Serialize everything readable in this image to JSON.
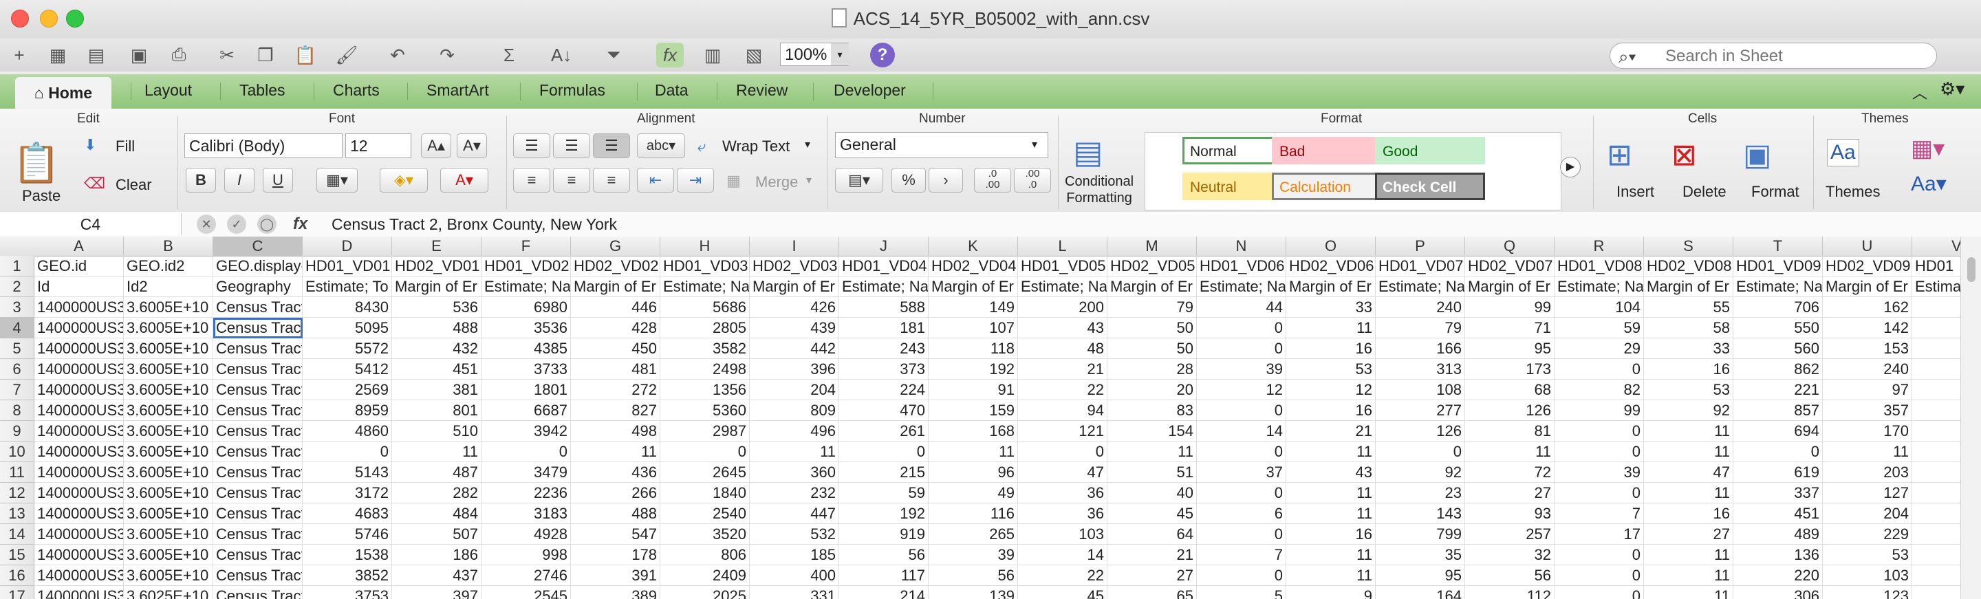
{
  "window": {
    "title": "ACS_14_5YR_B05002_with_ann.csv"
  },
  "toolbar": {
    "zoom": "100%",
    "search_placeholder": "Search in Sheet"
  },
  "ribbon_tabs": [
    "Home",
    "Layout",
    "Tables",
    "Charts",
    "SmartArt",
    "Formulas",
    "Data",
    "Review",
    "Developer"
  ],
  "ribbon": {
    "groups": {
      "edit": "Edit",
      "font": "Font",
      "alignment": "Alignment",
      "number": "Number",
      "format": "Format",
      "cells": "Cells",
      "themes": "Themes"
    },
    "paste": "Paste",
    "fill": "Fill",
    "clear": "Clear",
    "font_name": "Calibri (Body)",
    "font_size": "12",
    "bold": "B",
    "italic": "I",
    "underline": "U",
    "wrap_text": "Wrap Text",
    "merge": "Merge",
    "abc": "abc",
    "number_format": "General",
    "percent": "%",
    "comma": "›",
    "dec_inc": ".0\n.00",
    "dec_dec": ".00\n.0",
    "conditional_formatting": "Conditional\nFormatting",
    "styles": [
      {
        "name": "Normal",
        "bg": "#ffffff",
        "color": "#222222",
        "border": "#5aa65a"
      },
      {
        "name": "Bad",
        "bg": "#ffc7ce",
        "color": "#9c0006",
        "border": "#ffc7ce"
      },
      {
        "name": "Good",
        "bg": "#c6efce",
        "color": "#006100",
        "border": "#c6efce"
      },
      {
        "name": "Neutral",
        "bg": "#ffeb9c",
        "color": "#9c6500",
        "border": "#ffeb9c"
      },
      {
        "name": "Calculation",
        "bg": "#f2f2f2",
        "color": "#fa7d00",
        "border": "#7f7f7f"
      },
      {
        "name": "Check Cell",
        "bg": "#a5a5a5",
        "color": "#ffffff",
        "border": "#3f3f3f"
      }
    ],
    "insert": "Insert",
    "delete": "Delete",
    "format_cells": "Format",
    "themes_btn": "Themes",
    "font_theme": "Aa"
  },
  "formula_bar": {
    "cell_ref": "C4",
    "fx": "fx",
    "content": "Census Tract 2, Bronx County, New York"
  },
  "sheet": {
    "columns": [
      "A",
      "B",
      "C",
      "D",
      "E",
      "F",
      "G",
      "H",
      "I",
      "J",
      "K",
      "L",
      "M",
      "N",
      "O",
      "P",
      "Q",
      "R",
      "S",
      "T",
      "U",
      "V"
    ],
    "row_numbers": [
      1,
      2,
      3,
      4,
      5,
      6,
      7,
      8,
      9,
      10,
      11,
      12,
      13,
      14,
      15,
      16,
      17
    ],
    "rows": [
      [
        "GEO.id",
        "GEO.id2",
        "GEO.display-",
        "HD01_VD01",
        "HD02_VD01",
        "HD01_VD02",
        "HD02_VD02",
        "HD01_VD03",
        "HD02_VD03",
        "HD01_VD04",
        "HD02_VD04",
        "HD01_VD05",
        "HD02_VD05",
        "HD01_VD06",
        "HD02_VD06",
        "HD01_VD07",
        "HD02_VD07",
        "HD01_VD08",
        "HD02_VD08",
        "HD01_VD09",
        "HD02_VD09",
        "HD01"
      ],
      [
        "Id",
        "Id2",
        "Geography",
        "Estimate; To",
        "Margin of Er",
        "Estimate; Na",
        "Margin of Er",
        "Estimate; Na",
        "Margin of Er",
        "Estimate; Na",
        "Margin of Er",
        "Estimate; Na",
        "Margin of Er",
        "Estimate; Na",
        "Margin of Er",
        "Estimate; Na",
        "Margin of Er",
        "Estimate; Na",
        "Margin of Er",
        "Estimate; Na",
        "Margin of Er",
        "Estima"
      ],
      [
        "1400000US3",
        "3.6005E+10",
        "Census Tract",
        "8430",
        "536",
        "6980",
        "446",
        "5686",
        "426",
        "588",
        "149",
        "200",
        "79",
        "44",
        "33",
        "240",
        "99",
        "104",
        "55",
        "706",
        "162",
        ""
      ],
      [
        "1400000US3",
        "3.6005E+10",
        "Census Tract",
        "5095",
        "488",
        "3536",
        "428",
        "2805",
        "439",
        "181",
        "107",
        "43",
        "50",
        "0",
        "11",
        "79",
        "71",
        "59",
        "58",
        "550",
        "142",
        ""
      ],
      [
        "1400000US3",
        "3.6005E+10",
        "Census Tract",
        "5572",
        "432",
        "4385",
        "450",
        "3582",
        "442",
        "243",
        "118",
        "48",
        "50",
        "0",
        "16",
        "166",
        "95",
        "29",
        "33",
        "560",
        "153",
        ""
      ],
      [
        "1400000US3",
        "3.6005E+10",
        "Census Tract",
        "5412",
        "451",
        "3733",
        "481",
        "2498",
        "396",
        "373",
        "192",
        "21",
        "28",
        "39",
        "53",
        "313",
        "173",
        "0",
        "16",
        "862",
        "240",
        ""
      ],
      [
        "1400000US3",
        "3.6005E+10",
        "Census Tract",
        "2569",
        "381",
        "1801",
        "272",
        "1356",
        "204",
        "224",
        "91",
        "22",
        "20",
        "12",
        "12",
        "108",
        "68",
        "82",
        "53",
        "221",
        "97",
        ""
      ],
      [
        "1400000US3",
        "3.6005E+10",
        "Census Tract",
        "8959",
        "801",
        "6687",
        "827",
        "5360",
        "809",
        "470",
        "159",
        "94",
        "83",
        "0",
        "16",
        "277",
        "126",
        "99",
        "92",
        "857",
        "357",
        ""
      ],
      [
        "1400000US3",
        "3.6005E+10",
        "Census Tract",
        "4860",
        "510",
        "3942",
        "498",
        "2987",
        "496",
        "261",
        "168",
        "121",
        "154",
        "14",
        "21",
        "126",
        "81",
        "0",
        "11",
        "694",
        "170",
        ""
      ],
      [
        "1400000US3",
        "3.6005E+10",
        "Census Tract",
        "0",
        "11",
        "0",
        "11",
        "0",
        "11",
        "0",
        "11",
        "0",
        "11",
        "0",
        "11",
        "0",
        "11",
        "0",
        "11",
        "0",
        "11",
        ""
      ],
      [
        "1400000US3",
        "3.6005E+10",
        "Census Tract",
        "5143",
        "487",
        "3479",
        "436",
        "2645",
        "360",
        "215",
        "96",
        "47",
        "51",
        "37",
        "43",
        "92",
        "72",
        "39",
        "47",
        "619",
        "203",
        ""
      ],
      [
        "1400000US3",
        "3.6005E+10",
        "Census Tract",
        "3172",
        "282",
        "2236",
        "266",
        "1840",
        "232",
        "59",
        "49",
        "36",
        "40",
        "0",
        "11",
        "23",
        "27",
        "0",
        "11",
        "337",
        "127",
        ""
      ],
      [
        "1400000US3",
        "3.6005E+10",
        "Census Tract",
        "4683",
        "484",
        "3183",
        "488",
        "2540",
        "447",
        "192",
        "116",
        "36",
        "45",
        "6",
        "11",
        "143",
        "93",
        "7",
        "16",
        "451",
        "204",
        ""
      ],
      [
        "1400000US3",
        "3.6005E+10",
        "Census Tract",
        "5746",
        "507",
        "4928",
        "547",
        "3520",
        "532",
        "919",
        "265",
        "103",
        "64",
        "0",
        "16",
        "799",
        "257",
        "17",
        "27",
        "489",
        "229",
        ""
      ],
      [
        "1400000US3",
        "3.6005E+10",
        "Census Tract",
        "1538",
        "186",
        "998",
        "178",
        "806",
        "185",
        "56",
        "39",
        "14",
        "21",
        "7",
        "11",
        "35",
        "32",
        "0",
        "11",
        "136",
        "53",
        ""
      ],
      [
        "1400000US3",
        "3.6005E+10",
        "Census Tract",
        "3852",
        "437",
        "2746",
        "391",
        "2409",
        "400",
        "117",
        "56",
        "22",
        "27",
        "0",
        "11",
        "95",
        "56",
        "0",
        "11",
        "220",
        "103",
        ""
      ],
      [
        "1400000US3",
        "3.6025E+10",
        "Census Tract",
        "3753",
        "397",
        "2545",
        "389",
        "2025",
        "331",
        "214",
        "139",
        "45",
        "65",
        "5",
        "9",
        "164",
        "112",
        "0",
        "11",
        "306",
        "123",
        ""
      ]
    ]
  }
}
